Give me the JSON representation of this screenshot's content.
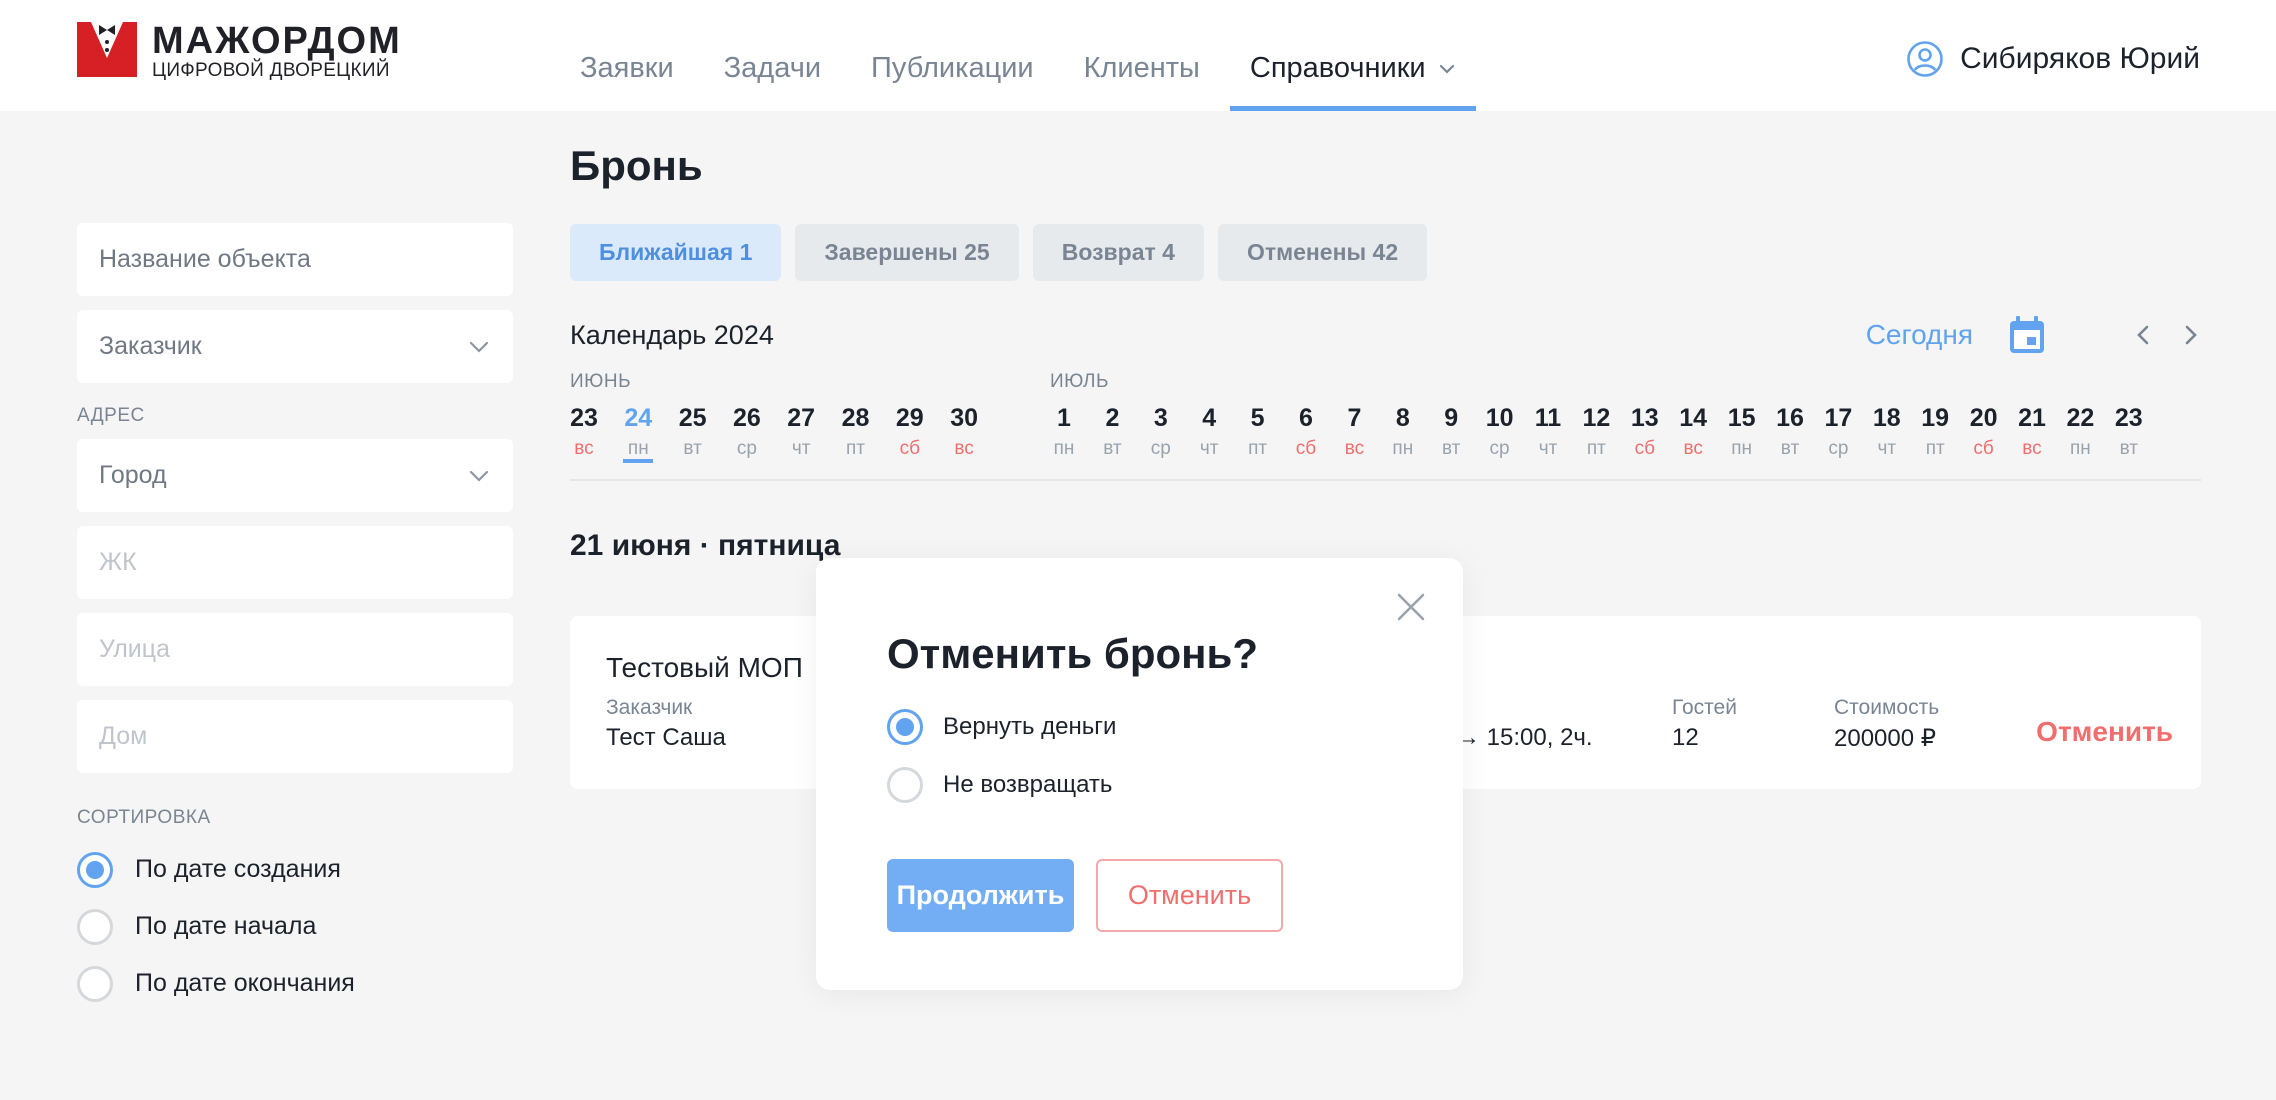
{
  "header": {
    "logo_title": "МАЖОРДОМ",
    "logo_subtitle": "ЦИФРОВОЙ ДВОРЕЦКИЙ",
    "nav": [
      {
        "label": "Заявки"
      },
      {
        "label": "Задачи"
      },
      {
        "label": "Публикации"
      },
      {
        "label": "Клиенты"
      },
      {
        "label": "Справочники",
        "active": true
      }
    ],
    "user_name": "Сибиряков Юрий"
  },
  "sidebar": {
    "object_placeholder": "Название объекта",
    "customer_placeholder": "Заказчик",
    "address_label": "АДРЕС",
    "city_placeholder": "Город",
    "complex_placeholder": "ЖК",
    "street_placeholder": "Улица",
    "house_placeholder": "Дом",
    "sort_label": "СОРТИРОВКА",
    "sort_options": [
      {
        "label": "По дате создания",
        "selected": true
      },
      {
        "label": "По дате начала",
        "selected": false
      },
      {
        "label": "По дате окончания",
        "selected": false
      }
    ]
  },
  "main": {
    "title": "Бронь",
    "tabs": [
      {
        "label": "Ближайшая 1",
        "active": true
      },
      {
        "label": "Завершены 25"
      },
      {
        "label": "Возврат 4"
      },
      {
        "label": "Отменены 42"
      }
    ],
    "calendar": {
      "title": "Календарь 2024",
      "today_label": "Сегодня",
      "months": [
        "ИЮНЬ",
        "ИЮЛЬ"
      ],
      "june_days": [
        {
          "n": "23",
          "wd": "вс",
          "we": true
        },
        {
          "n": "24",
          "wd": "пн",
          "sel": true
        },
        {
          "n": "25",
          "wd": "вт"
        },
        {
          "n": "26",
          "wd": "ср"
        },
        {
          "n": "27",
          "wd": "чт"
        },
        {
          "n": "28",
          "wd": "пт"
        },
        {
          "n": "29",
          "wd": "сб",
          "we": true
        },
        {
          "n": "30",
          "wd": "вс",
          "we": true
        }
      ],
      "july_days": [
        {
          "n": "1",
          "wd": "пн"
        },
        {
          "n": "2",
          "wd": "вт"
        },
        {
          "n": "3",
          "wd": "ср"
        },
        {
          "n": "4",
          "wd": "чт"
        },
        {
          "n": "5",
          "wd": "пт"
        },
        {
          "n": "6",
          "wd": "сб",
          "we": true
        },
        {
          "n": "7",
          "wd": "вс",
          "we": true
        },
        {
          "n": "8",
          "wd": "пн"
        },
        {
          "n": "9",
          "wd": "вт"
        },
        {
          "n": "10",
          "wd": "ср"
        },
        {
          "n": "11",
          "wd": "чт"
        },
        {
          "n": "12",
          "wd": "пт"
        },
        {
          "n": "13",
          "wd": "сб",
          "we": true
        },
        {
          "n": "14",
          "wd": "вс",
          "we": true
        },
        {
          "n": "15",
          "wd": "пн"
        },
        {
          "n": "16",
          "wd": "вт"
        },
        {
          "n": "17",
          "wd": "ср"
        },
        {
          "n": "18",
          "wd": "чт"
        },
        {
          "n": "19",
          "wd": "пт"
        },
        {
          "n": "20",
          "wd": "сб",
          "we": true
        },
        {
          "n": "21",
          "wd": "вс",
          "we": true
        },
        {
          "n": "22",
          "wd": "пн"
        },
        {
          "n": "23",
          "wd": "вт"
        }
      ]
    },
    "date_heading": "21 июня · пятница",
    "booking": {
      "name": "Тестовый МОП",
      "customer_label": "Заказчик",
      "customer_value": "Тест Саша",
      "time_value": "→ 15:00, 2ч.",
      "guests_label": "Гостей",
      "guests_value": "12",
      "cost_label": "Стоимость",
      "cost_value": "200000 ₽",
      "cancel_label": "Отменить"
    }
  },
  "modal": {
    "title": "Отменить бронь?",
    "options": [
      {
        "label": "Вернуть деньги",
        "selected": true
      },
      {
        "label": "Не возвращать",
        "selected": false
      }
    ],
    "continue_label": "Продолжить",
    "cancel_label": "Отменить"
  },
  "colors": {
    "accent": "#62a3ef",
    "danger": "#f06e6e",
    "background": "#f4f5f4"
  }
}
